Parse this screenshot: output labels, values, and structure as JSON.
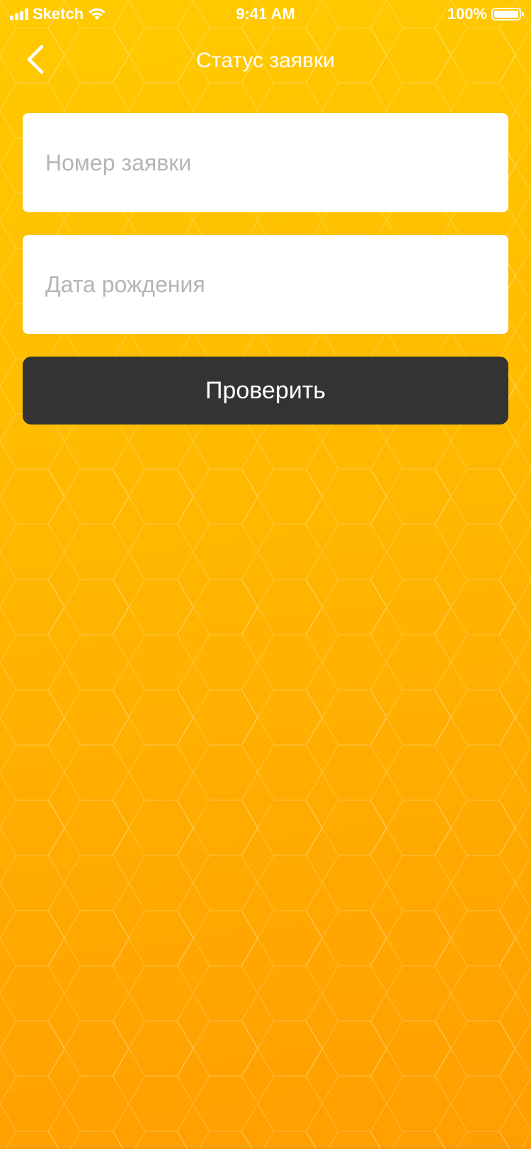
{
  "status_bar": {
    "carrier": "Sketch",
    "time": "9:41 AM",
    "battery_percent": "100%",
    "battery_level": 1.0,
    "icons": [
      "signal-icon",
      "wifi-icon",
      "battery-icon"
    ]
  },
  "nav": {
    "title": "Статус заявки",
    "back_icon": "chevron-left-icon"
  },
  "form": {
    "application_number": {
      "value": "",
      "placeholder": "Номер заявки"
    },
    "birth_date": {
      "value": "",
      "placeholder": "Дата рождения"
    },
    "submit_label": "Проверить"
  },
  "colors": {
    "background_top": "#FFCA00",
    "background_bottom": "#FF9E00",
    "button": "#333333",
    "field": "#FFFFFF",
    "placeholder": "#B5B5B5",
    "text_on_bg": "#FFFFFF"
  }
}
